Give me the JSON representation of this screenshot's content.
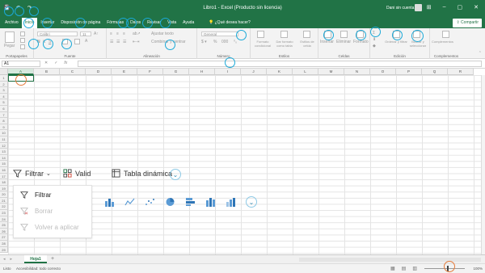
{
  "titlebar": {
    "title": "Libro1 - Excel (Producto sin licencia)",
    "user": "Dani sin cuenta",
    "minimize": "–",
    "restore": "▢",
    "close": "✕",
    "options": "⊞"
  },
  "menu": {
    "tabs": [
      "Archivo",
      "Inicio",
      "Insertar",
      "Disposición de página",
      "Fórmulas",
      "Datos",
      "Revisar",
      "Vista",
      "Ayuda"
    ],
    "active": "Inicio",
    "tell_me": "¿Qué desea hacer?",
    "share": "Compartir"
  },
  "ribbon": {
    "groups": [
      {
        "name": "Portapapeles",
        "label": "Portapapeles"
      },
      {
        "name": "Fuente",
        "label": "Fuente"
      },
      {
        "name": "Alineación",
        "label": "Alineación"
      },
      {
        "name": "Número",
        "label": "Número"
      },
      {
        "name": "Estilos",
        "label": "Estilos"
      },
      {
        "name": "Celdas",
        "label": "Celdas"
      },
      {
        "name": "Edición",
        "label": "Edición"
      },
      {
        "name": "Complementos",
        "label": "Complementos"
      }
    ],
    "paste": "Pegar",
    "font_name": "Calibri",
    "font_size": "11",
    "wrap_text": "Ajustar texto",
    "merge_center": "Combinar y centrar",
    "number_format": "General",
    "cond_format": "Formato condicional",
    "format_table": "Dar formato como tabla",
    "cell_styles": "Estilos de celda",
    "insert": "Insertar",
    "delete": "Eliminar",
    "format": "Formato",
    "sort_filter": "Ordenar y filtrar",
    "find_select": "Buscar y seleccionar",
    "addins": "Complementos"
  },
  "formula_bar": {
    "namebox": "A1",
    "cancel": "✕",
    "enter": "✓",
    "fx": "fx",
    "value": ""
  },
  "columns": [
    "A",
    "B",
    "C",
    "D",
    "E",
    "F",
    "G",
    "H",
    "I",
    "J",
    "K",
    "L",
    "M",
    "N",
    "O",
    "P",
    "Q",
    "R"
  ],
  "rows": [
    "1",
    "2",
    "3",
    "4",
    "5",
    "6",
    "7",
    "8",
    "9",
    "10",
    "11",
    "12",
    "13",
    "14",
    "15",
    "16",
    "17",
    "18",
    "19",
    "20",
    "21",
    "22",
    "23",
    "24",
    "25",
    "26",
    "27",
    "28",
    "29"
  ],
  "sheets": {
    "active": "Hoja1",
    "add": "+"
  },
  "status": {
    "ready": "Listo",
    "accessibility": "Accesibilidad: todo correcto",
    "zoom": "100%"
  },
  "overlay": {
    "filter_label": "Filtrar",
    "validate_label": "Valid",
    "pivot_label": "Tabla dinámica",
    "menu_items": [
      {
        "label": "Filtrar",
        "enabled": true
      },
      {
        "label": "Borrar",
        "enabled": false
      },
      {
        "label": "Volver a aplicar",
        "enabled": false
      }
    ]
  },
  "colors": {
    "accent": "#217346",
    "highlight": "#1ba9d8",
    "highlight_alt": "#e57b3b"
  }
}
